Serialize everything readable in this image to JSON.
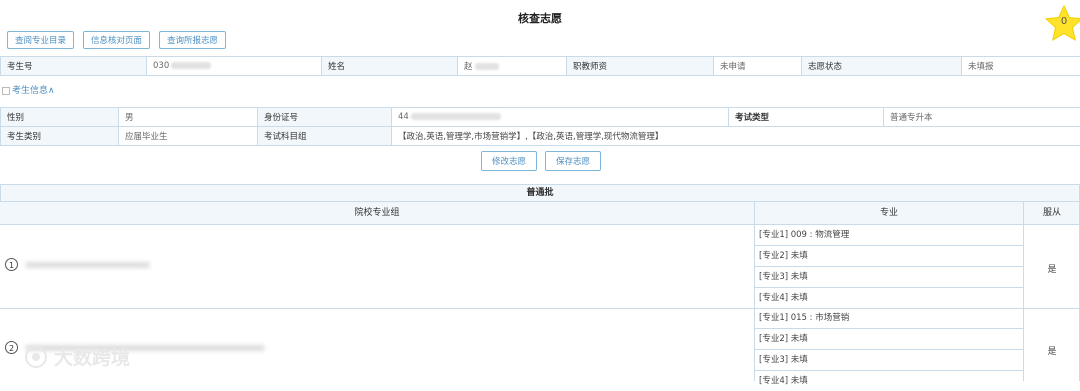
{
  "page": {
    "title": "核查志愿"
  },
  "badge": {
    "count": "0",
    "color": "#ffe32a"
  },
  "toolbar": {
    "buttons": [
      "查阅专业目录",
      "信息核对页面",
      "查询所报志愿"
    ]
  },
  "summary": {
    "exam_no_label": "考生号",
    "exam_no_value": "030",
    "name_label": "姓名",
    "name_value": "赵",
    "auth_label": "职教师资",
    "auth_value": "未申请",
    "status_label": "志愿状态",
    "status_value": "未填报"
  },
  "info_toggle": "考生信息∧",
  "info": {
    "gender_label": "性别",
    "gender_value": "男",
    "id_label": "身份证号",
    "id_value": "44",
    "exam_type_label": "考试类型",
    "exam_type_value": "普通专升本",
    "cat_label": "考生类别",
    "cat_value": "应届毕业生",
    "subject_label": "考试科目组",
    "subject_value": "【政治,英语,管理学,市场营销学】,【政治,英语,管理学,现代物流管理】"
  },
  "actions": {
    "modify": "修改志愿",
    "save": "保存志愿"
  },
  "batch": {
    "title": "普通批",
    "col_group": "院校专业组",
    "col_major": "专业",
    "col_obey": "服从",
    "groups": [
      {
        "index": "1",
        "majors": [
          "[专业1] 009 : 物流管理",
          "[专业2] 未填",
          "[专业3] 未填",
          "[专业4] 未填"
        ],
        "obey": "是"
      },
      {
        "index": "2",
        "majors": [
          "[专业1] 015 : 市场营销",
          "[专业2] 未填",
          "[专业3] 未填",
          "[专业4] 未填"
        ],
        "obey": "是"
      }
    ]
  },
  "watermark": "大数跨境"
}
